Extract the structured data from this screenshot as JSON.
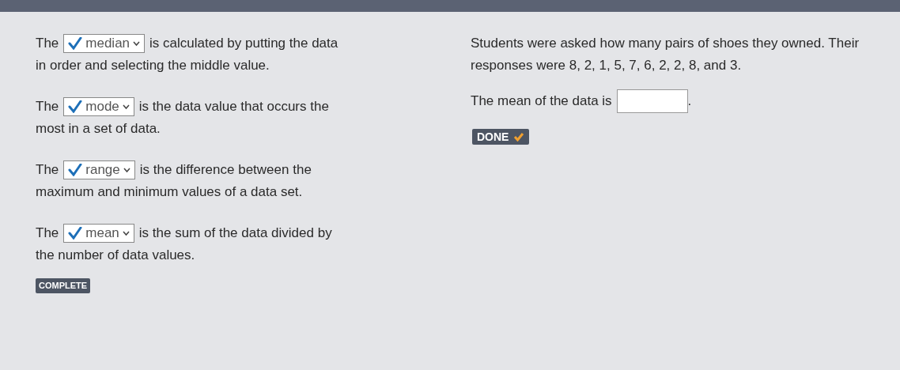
{
  "statements": [
    {
      "before": "The",
      "answer": "median",
      "correct": true,
      "after": "is calculated by putting the data",
      "continuation": "in order and selecting the middle value."
    },
    {
      "before": "The",
      "answer": "mode",
      "correct": true,
      "after": "is the data value that occurs the",
      "continuation": "most in a set of data."
    },
    {
      "before": "The",
      "answer": "range",
      "correct": true,
      "after": "is the difference between the",
      "continuation": "maximum and minimum values of a data set."
    },
    {
      "before": "The",
      "answer": "mean",
      "correct": true,
      "after": "is the sum of the data divided by",
      "continuation": "the number of data values."
    }
  ],
  "status_badge": "COMPLETE",
  "problem": {
    "text": "Students were asked how many pairs of shoes they owned. Their responses were 8, 2, 1, 5, 7, 6, 2, 2, 8, and 3.",
    "question_before": "The mean of the data is",
    "question_after": ".",
    "done_button": {
      "label": "DONE",
      "completed": true
    }
  }
}
